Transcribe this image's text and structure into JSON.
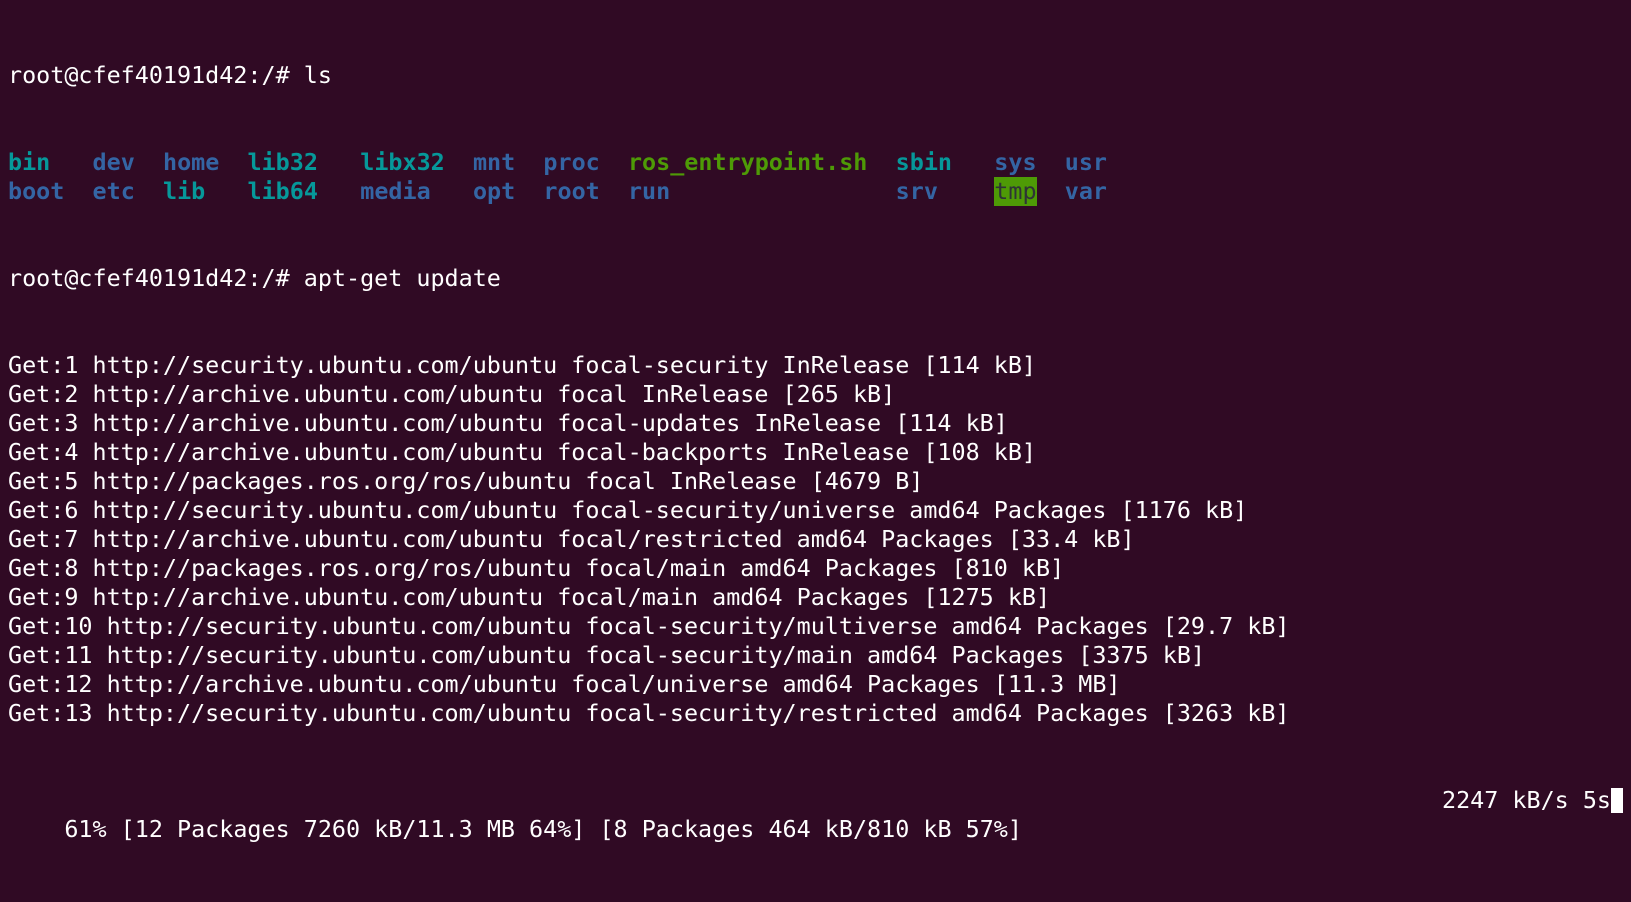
{
  "terminal": {
    "prompt": "root@cfef40191d42:/# ",
    "commands": [
      "ls",
      "apt-get update"
    ],
    "ls_rows": [
      [
        {
          "name": "bin",
          "type": "link",
          "col": 0
        },
        {
          "name": "dev",
          "type": "dir",
          "col": 6
        },
        {
          "name": "home",
          "type": "dir",
          "col": 11
        },
        {
          "name": "lib32",
          "type": "link",
          "col": 17
        },
        {
          "name": "libx32",
          "type": "link",
          "col": 25
        },
        {
          "name": "mnt",
          "type": "dir",
          "col": 33
        },
        {
          "name": "proc",
          "type": "dir",
          "col": 38
        },
        {
          "name": "ros_entrypoint.sh",
          "type": "exec",
          "col": 44
        },
        {
          "name": "sbin",
          "type": "link",
          "col": 63
        },
        {
          "name": "sys",
          "type": "dir",
          "col": 70
        },
        {
          "name": "usr",
          "type": "dir",
          "col": 75
        }
      ],
      [
        {
          "name": "boot",
          "type": "dir",
          "col": 0
        },
        {
          "name": "etc",
          "type": "dir",
          "col": 6
        },
        {
          "name": "lib",
          "type": "link",
          "col": 11
        },
        {
          "name": "lib64",
          "type": "link",
          "col": 17
        },
        {
          "name": "media",
          "type": "dir",
          "col": 25
        },
        {
          "name": "opt",
          "type": "dir",
          "col": 33
        },
        {
          "name": "root",
          "type": "dir",
          "col": 38
        },
        {
          "name": "run",
          "type": "dir",
          "col": 44
        },
        {
          "name": "srv",
          "type": "dir",
          "col": 63
        },
        {
          "name": "tmp",
          "type": "sticky",
          "col": 70
        },
        {
          "name": "var",
          "type": "dir",
          "col": 75
        }
      ]
    ],
    "output": [
      "Get:1 http://security.ubuntu.com/ubuntu focal-security InRelease [114 kB]",
      "Get:2 http://archive.ubuntu.com/ubuntu focal InRelease [265 kB]",
      "Get:3 http://archive.ubuntu.com/ubuntu focal-updates InRelease [114 kB]",
      "Get:4 http://archive.ubuntu.com/ubuntu focal-backports InRelease [108 kB]",
      "Get:5 http://packages.ros.org/ros/ubuntu focal InRelease [4679 B]",
      "Get:6 http://security.ubuntu.com/ubuntu focal-security/universe amd64 Packages [1176 kB]",
      "Get:7 http://archive.ubuntu.com/ubuntu focal/restricted amd64 Packages [33.4 kB]",
      "Get:8 http://packages.ros.org/ros/ubuntu focal/main amd64 Packages [810 kB]",
      "Get:9 http://archive.ubuntu.com/ubuntu focal/main amd64 Packages [1275 kB]",
      "Get:10 http://security.ubuntu.com/ubuntu focal-security/multiverse amd64 Packages [29.7 kB]",
      "Get:11 http://security.ubuntu.com/ubuntu focal-security/main amd64 Packages [3375 kB]",
      "Get:12 http://archive.ubuntu.com/ubuntu focal/universe amd64 Packages [11.3 MB]",
      "Get:13 http://security.ubuntu.com/ubuntu focal-security/restricted amd64 Packages [3263 kB]"
    ],
    "progress": {
      "status": "61% [12 Packages 7260 kB/11.3 MB 64%] [8 Packages 464 kB/810 kB 57%]",
      "rate_eta": "2247 kB/s 5s"
    }
  },
  "colors": {
    "background": "#300a24",
    "dir": "#3465a4",
    "link": "#06989a",
    "exec": "#4e9a06",
    "text": "#ffffff"
  }
}
